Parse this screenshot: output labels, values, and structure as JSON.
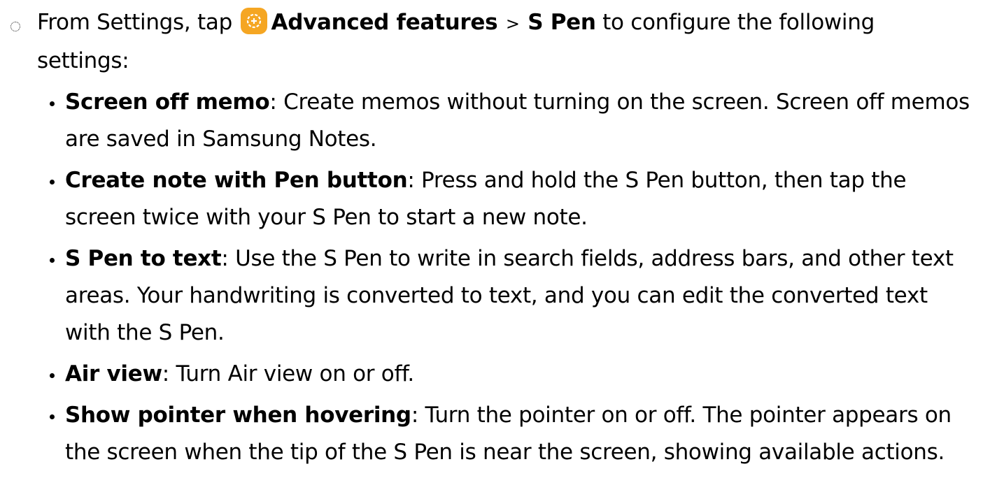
{
  "step": {
    "prefix": "From Settings, tap ",
    "icon": "settings-advanced-features-icon",
    "link1": "Advanced features",
    "separator": ">",
    "link2": "S Pen",
    "suffix": " to configure the following settings:"
  },
  "bullets": [
    {
      "term": "Screen off memo",
      "colon": ":",
      "desc": " Create memos without turning on the screen. Screen off memos are saved in Samsung Notes."
    },
    {
      "term": "Create note with Pen button",
      "colon": ":",
      "desc": " Press and hold the S Pen button, then tap the screen twice with your S Pen to start a new note."
    },
    {
      "term": "S Pen to text",
      "colon": ":",
      "desc": " Use the S Pen to write in search fields, address bars, and other text areas. Your handwriting is converted to text, and you can edit the converted text with the S Pen."
    },
    {
      "term": "Air view",
      "colon": ":",
      "desc": " Turn Air view on or off."
    },
    {
      "term": "Show pointer when hovering",
      "colon": ":",
      "desc": " Turn the pointer on or off. The pointer appears on the screen when the tip of the S Pen is near the screen, showing available actions."
    }
  ],
  "colors": {
    "icon_background": "#f5a623",
    "text": "#000000"
  }
}
